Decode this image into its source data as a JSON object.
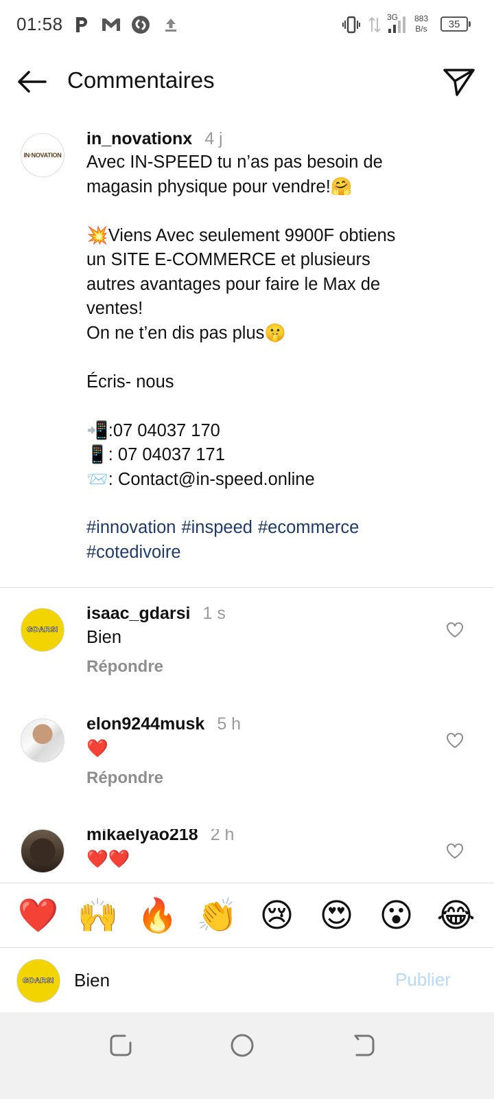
{
  "status_bar": {
    "time": "01:58",
    "network_type": "3G",
    "net_speed_value": "883",
    "net_speed_unit": "B/s",
    "battery": "35"
  },
  "header": {
    "title": "Commentaires"
  },
  "caption": {
    "avatar_text": "IN·NOVATION",
    "username": "in_novationx",
    "timestamp": "4 j",
    "text": "Avec IN-SPEED tu n’as pas besoin de\nmagasin physique pour vendre!🤗\n\n💥Viens Avec seulement 9900F obtiens\nun SITE E-COMMERCE et plusieurs\nautres avantages pour faire le Max de\nventes!\nOn ne t’en dis pas plus🤫\n\nÉcris- nous\n\n📲:07 04037 170\n📱: 07 04037 171\n📨: Contact@in-speed.online",
    "hashtags": [
      "#innovation",
      "#inspeed",
      "#ecommerce",
      "#cotedivoire"
    ]
  },
  "comments": [
    {
      "username": "isaac_gdarsi",
      "timestamp": "1 s",
      "text": "Bien",
      "reply_label": "Répondre",
      "avatar_text": "GDARSI"
    },
    {
      "username": "elon9244musk",
      "timestamp": "5 h",
      "text": "❤️",
      "reply_label": "Répondre"
    },
    {
      "username": "mikaelyao218",
      "timestamp": "2 h",
      "text": "❤️❤️"
    }
  ],
  "emoji_bar": [
    "❤️",
    "🙌",
    "🔥",
    "👏",
    "😢",
    "😍",
    "😮",
    "😂"
  ],
  "input": {
    "avatar_text": "GDARSI",
    "value": "Bien",
    "publish_label": "Publier"
  },
  "colors": {
    "hashtag": "#1f3a66",
    "publish_disabled": "#b7daf7",
    "timestamp": "#9a9a9a",
    "avatar_yellow": "#f2d400"
  },
  "icons": {
    "back": "arrow-left-icon",
    "send": "paper-plane-icon",
    "like": "heart-outline-icon"
  }
}
